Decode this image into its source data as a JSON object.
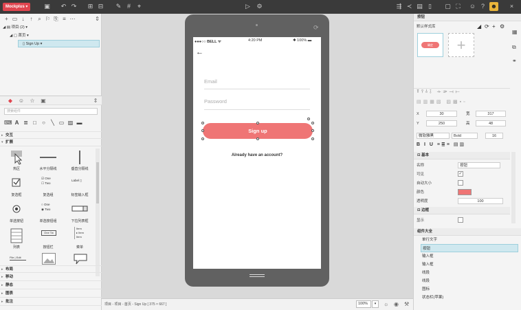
{
  "toolbar": {
    "brand": "Mockplus"
  },
  "tree": {
    "project": "项目 (2)",
    "home": "首页",
    "page": "Sign Up"
  },
  "library": {
    "search_placeholder": "搜索组件",
    "sections_top": [
      "交互",
      "扩展"
    ],
    "components": [
      "热区",
      "水平分隔线",
      "垂直分隔线",
      "复选框",
      "复选组",
      "标签输入框",
      "单选按钮",
      "单选按钮组",
      "下拉列表框",
      "列表",
      "按钮栏",
      "菜单"
    ],
    "checkbox_group_items": [
      "One",
      "Two"
    ],
    "label_input_text": "Label",
    "radio_group_items": [
      "One",
      "Two"
    ],
    "button_bar_text": "One Tw",
    "menu_items": [
      "Item",
      "Item",
      "Item"
    ],
    "file_edit_text": "File | Edit",
    "sections_bottom": [
      "布局",
      "移动",
      "静态",
      "图表",
      "批注"
    ]
  },
  "phone": {
    "carrier": "BELL",
    "time": "4:20 PM",
    "battery": "100%",
    "email": "Email",
    "password": "Password",
    "signup": "Sign up",
    "account": "Already have an account?"
  },
  "status": {
    "path": "项目 - 项目 - 首页 - Sign Up [ 375 × 667 ]",
    "zoom": "100%"
  },
  "right": {
    "title": "按钮",
    "style_lib": "默认样式库",
    "card_label": "确定",
    "pos": {
      "x": "30",
      "y": "250",
      "w": "317",
      "h": "48"
    },
    "font": {
      "family": "微软雅黑",
      "weight": "Bold",
      "size": "16"
    },
    "basic_header": "基本",
    "name_label": "名称",
    "name_value": "按钮",
    "visible_label": "可见",
    "autosize_label": "自动大小",
    "color_label": "颜色",
    "opacity_label": "透明度",
    "opacity_value": "100",
    "border_header": "边框",
    "show_label": "显示",
    "x_label": "X",
    "y_label": "Y",
    "w_label": "宽",
    "h_label": "高",
    "component_header": "组件大全",
    "components": [
      "单行文字",
      "按钮",
      "输入框",
      "输入框",
      "线段",
      "线段",
      "图标",
      "状态栏(苹果)"
    ],
    "accent": "#ef7575"
  }
}
